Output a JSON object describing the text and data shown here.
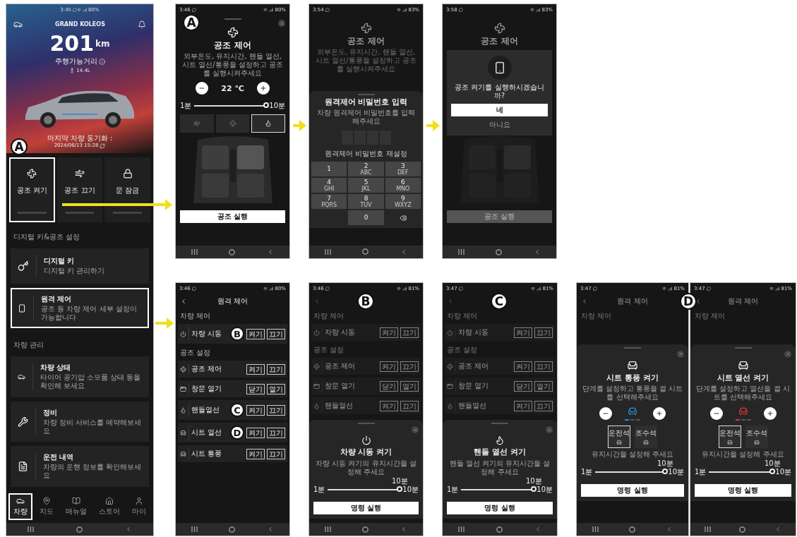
{
  "screens": [
    {
      "kind": "home",
      "time": "3:45",
      "battery": "80%",
      "title": "GRAND KOLEOS",
      "range_value": "201",
      "range_unit": "km",
      "range_label": "주행가능거리",
      "fuel": "14.4L",
      "sync_label": "마지막 차량 동기화 :",
      "sync_time": "2024/06/13 15:28",
      "quick_actions": [
        {
          "label": "공조 켜기",
          "highlighted": true,
          "callout": "A"
        },
        {
          "label": "공조 끄기",
          "highlighted": false
        },
        {
          "label": "문 잠금",
          "highlighted": false
        }
      ],
      "sections": [
        {
          "title": "디지털 키&공조 설정",
          "items": [
            {
              "title": "디지털 키",
              "subtitle": "디지털 키 관리하기",
              "highlighted": false
            },
            {
              "title": "원격 제어",
              "subtitle": "공조 등 차량 제어 세부 설정이 가능합니다",
              "highlighted": true
            }
          ]
        },
        {
          "title": "차량 관리",
          "items": [
            {
              "title": "차량 상태",
              "subtitle": "타이어 공기압 소모품 상태 등을 확인해 보세요",
              "highlighted": false
            },
            {
              "title": "정비",
              "subtitle": "차량 정비 서비스를 예약해보세요",
              "highlighted": false
            },
            {
              "title": "운전 내역",
              "subtitle": "차량의 운행 정보를 확인해보세요",
              "highlighted": false
            }
          ]
        }
      ],
      "nav": [
        {
          "label": "차량",
          "selected": true
        },
        {
          "label": "지도",
          "selected": false
        },
        {
          "label": "매뉴얼",
          "selected": false
        },
        {
          "label": "스토어",
          "selected": false
        },
        {
          "label": "마이",
          "selected": false
        }
      ]
    },
    {
      "kind": "climate",
      "time": "3:46",
      "battery": "80%",
      "callout": "A",
      "title": "공조 제어",
      "description": "외부온도, 유지시간, 핸들 열선, 시트 열선/통풍을 설정하고 공조를 실행시켜주세요",
      "temperature": "22 ℃",
      "slider": {
        "min": "1분",
        "max": "10분",
        "level": 1
      },
      "modes": [
        {
          "selected": false
        },
        {
          "selected": false
        },
        {
          "selected": true
        }
      ],
      "button": "공조 실행"
    },
    {
      "kind": "pin",
      "time": "3:54",
      "battery": "83%",
      "bg_title": "공조 제어",
      "bg_description": "외부온도, 유지시간, 핸들 열선, 시트 열선/통풍을 설정하고 공조를 실행시켜주세요",
      "title": "원격제어 비밀번호 입력",
      "subtitle": "차량 원격제어 비밀번호를 입력해주세요",
      "reset": "원격제어 비밀번호 재설정",
      "keys": [
        {
          "digit": "1"
        },
        {
          "digit": "2",
          "letters": "ABC"
        },
        {
          "digit": "3",
          "letters": "DEF"
        },
        {
          "digit": "4",
          "letters": "GHI"
        },
        {
          "digit": "5",
          "letters": "JKL"
        },
        {
          "digit": "6",
          "letters": "MNO"
        },
        {
          "digit": "7",
          "letters": "PQRS"
        },
        {
          "digit": "8",
          "letters": "TUV"
        },
        {
          "digit": "9",
          "letters": "WXYZ"
        },
        {
          "digit": "0"
        }
      ]
    },
    {
      "kind": "confirm",
      "time": "3:58",
      "battery": "83%",
      "bg_title": "공조 제어",
      "question": "공조 켜기를 실행하시겠습니까?",
      "yes": "네",
      "no": "아니요",
      "bg_button": "공조 실행"
    },
    {
      "kind": "remote_list",
      "time": "3:46",
      "battery": "80%",
      "title": "원격 제어",
      "groups": [
        {
          "title": "차량 제어",
          "rows": [
            {
              "label": "차량 시동",
              "buttons": [
                "켜기",
                "끄기"
              ],
              "callout": "B"
            }
          ]
        },
        {
          "title": "공조 설정",
          "rows": [
            {
              "label": "공조 제어",
              "buttons": [
                "켜기",
                "끄기"
              ]
            },
            {
              "label": "창문 열기",
              "buttons": [
                "닫기",
                "열기"
              ]
            },
            {
              "label": "핸들열선",
              "buttons": [
                "켜기",
                "끄기"
              ],
              "callout": "C"
            },
            {
              "label": "시트 열선",
              "buttons": [
                "켜기",
                "끄기"
              ],
              "callout": "D"
            },
            {
              "label": "시트 통풍",
              "buttons": [
                "켜기",
                "끄기"
              ]
            }
          ]
        }
      ]
    },
    {
      "kind": "duration_sheet",
      "time": "3:46",
      "battery": "81%",
      "callout": "B",
      "bg_groups": [
        {
          "title": "차량 제어",
          "rows": [
            {
              "label": "차량 시동",
              "buttons": [
                "켜기",
                "끄기"
              ]
            }
          ]
        },
        {
          "title": "공조 설정",
          "rows": [
            {
              "label": "공조 제어",
              "buttons": [
                "켜기",
                "끄기"
              ]
            },
            {
              "label": "창문 열기",
              "buttons": [
                "닫기",
                "열기"
              ]
            },
            {
              "label": "핸들열선",
              "buttons": [
                "켜기",
                "끄기"
              ]
            }
          ]
        }
      ],
      "title": "차량 시동 켜기",
      "description": "차량 시동 켜기의 유지시간을 설정해 주세요",
      "slider": {
        "min": "1분",
        "max": "10분",
        "value": "10분",
        "level": 1
      },
      "button": "명령 실행"
    },
    {
      "kind": "duration_sheet",
      "time": "3:47",
      "battery": "81%",
      "callout": "C",
      "bg_groups": [
        {
          "title": "차량 제어",
          "rows": [
            {
              "label": "차량 시동",
              "buttons": [
                "켜기",
                "끄기"
              ]
            }
          ]
        },
        {
          "title": "공조 설정",
          "rows": [
            {
              "label": "공조 제어",
              "buttons": [
                "켜기",
                "끄기"
              ]
            },
            {
              "label": "창문 열기",
              "buttons": [
                "닫기",
                "열기"
              ]
            },
            {
              "label": "핸들열선",
              "buttons": [
                "켜기",
                "끄기"
              ]
            }
          ]
        }
      ],
      "title": "핸들 열선 켜기",
      "description": "핸들 열선 켜기의 유지시간을 설정해 주세요",
      "slider": {
        "min": "1분",
        "max": "10분",
        "value": "10분",
        "level": 1
      },
      "button": "명령 실행"
    },
    {
      "kind": "seat_sheet",
      "time": "3:47",
      "battery": "81%",
      "callout": "D",
      "bg_title": "원격 제어",
      "bg_section": "차량 제어",
      "title": "시트 통풍 켜기",
      "description": "단계를 설정하고 통풍을 켤 시트를 선택해주세요",
      "color": "#2b8fd8",
      "level": 0.33,
      "seats": [
        {
          "label": "운전석",
          "selected": true
        },
        {
          "label": "조수석",
          "selected": false
        }
      ],
      "hint": "유지시간을 설정해 주세요",
      "slider": {
        "min": "1분",
        "max": "10분",
        "value": "10분",
        "level": 1
      },
      "button": "명령 실행"
    },
    {
      "kind": "seat_sheet",
      "time": "3:47",
      "battery": "81%",
      "bg_title": "원격 제어",
      "bg_section": "차량 제어",
      "title": "시트 열선 켜기",
      "description": "단계를 설정하고 열선을 켤 시트를 선택해주세요",
      "color": "#d83a3a",
      "level": 0.33,
      "seats": [
        {
          "label": "운전석",
          "selected": true
        },
        {
          "label": "조수석",
          "selected": false
        }
      ],
      "hint": "유지시간을 설정해 주세요",
      "slider": {
        "min": "1분",
        "max": "10분",
        "value": "10분",
        "level": 1
      },
      "button": "명령 실행"
    }
  ]
}
